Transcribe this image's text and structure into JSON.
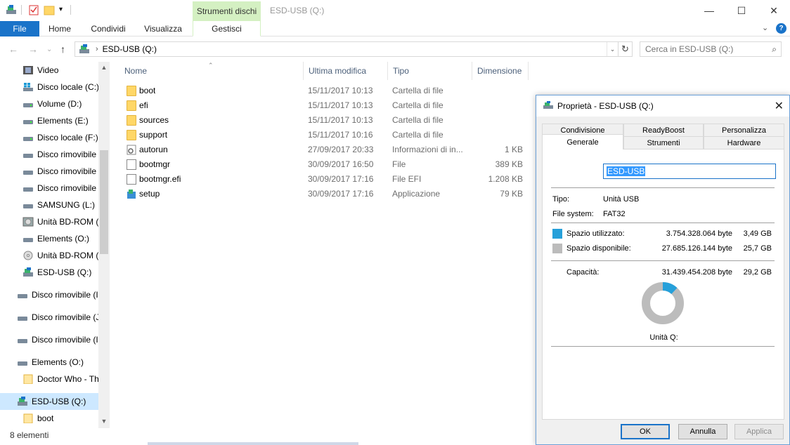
{
  "window": {
    "context_tab_header": "Strumenti dischi",
    "title": "ESD-USB (Q:)",
    "minimize_glyph": "—",
    "maximize_glyph": "☐",
    "close_glyph": "✕"
  },
  "ribbon": {
    "tabs": [
      "File",
      "Home",
      "Condividi",
      "Visualizza"
    ],
    "context_tab": "Gestisci",
    "collapse_glyph": "⌄",
    "help_glyph": "?"
  },
  "address": {
    "back_glyph": "←",
    "forward_glyph": "→",
    "recent_glyph": "⌄",
    "up_glyph": "↑",
    "chevron": "›",
    "path": "ESD-USB (Q:)",
    "dropdown_glyph": "⌄",
    "refresh_glyph": "↻",
    "search_placeholder": "Cerca in ESD-USB (Q:)",
    "search_glyph": "⌕"
  },
  "nav": {
    "items": [
      {
        "label": "Video",
        "icon": "video-icon"
      },
      {
        "label": "Disco locale (C:)",
        "icon": "windows-drive-icon"
      },
      {
        "label": "Volume (D:)",
        "icon": "drive-icon"
      },
      {
        "label": "Elements (E:)",
        "icon": "drive-icon"
      },
      {
        "label": "Disco locale (F:)",
        "icon": "drive-icon"
      },
      {
        "label": "Disco rimovibile",
        "icon": "drive-icon"
      },
      {
        "label": "Disco rimovibile",
        "icon": "drive-icon"
      },
      {
        "label": "Disco rimovibile",
        "icon": "drive-icon"
      },
      {
        "label": "SAMSUNG (L:)",
        "icon": "drive-icon"
      },
      {
        "label": "Unità BD-ROM (",
        "icon": "bd-rom-icon"
      },
      {
        "label": "Elements (O:)",
        "icon": "drive-icon"
      },
      {
        "label": "Unità BD-ROM (",
        "icon": "bd-rom-icon"
      },
      {
        "label": "ESD-USB (Q:)",
        "icon": "usb-drive-icon"
      },
      {
        "label": "Disco rimovibile (I",
        "icon": "drive-icon"
      },
      {
        "label": "Disco rimovibile (J",
        "icon": "drive-icon"
      },
      {
        "label": "Disco rimovibile (I",
        "icon": "drive-icon"
      },
      {
        "label": "Elements (O:)",
        "icon": "drive-icon"
      },
      {
        "label": "Doctor Who - Th",
        "icon": "folder-icon"
      },
      {
        "label": "ESD-USB (Q:)",
        "icon": "usb-drive-icon"
      },
      {
        "label": "boot",
        "icon": "folder-icon"
      }
    ],
    "scroll_up_glyph": "▲",
    "scroll_down_glyph": "▼"
  },
  "files": {
    "columns": {
      "name": "Nome",
      "modified": "Ultima modifica",
      "type": "Tipo",
      "size": "Dimensione"
    },
    "sort_glyph": "⌃",
    "rows": [
      {
        "name": "boot",
        "modified": "15/11/2017 10:13",
        "type": "Cartella di file",
        "size": "",
        "kind": "folder"
      },
      {
        "name": "efi",
        "modified": "15/11/2017 10:13",
        "type": "Cartella di file",
        "size": "",
        "kind": "folder"
      },
      {
        "name": "sources",
        "modified": "15/11/2017 10:13",
        "type": "Cartella di file",
        "size": "",
        "kind": "folder"
      },
      {
        "name": "support",
        "modified": "15/11/2017 10:16",
        "type": "Cartella di file",
        "size": "",
        "kind": "folder"
      },
      {
        "name": "autorun",
        "modified": "27/09/2017 20:33",
        "type": "Informazioni di in...",
        "size": "1 KB",
        "kind": "settings"
      },
      {
        "name": "bootmgr",
        "modified": "30/09/2017 16:50",
        "type": "File",
        "size": "389 KB",
        "kind": "doc"
      },
      {
        "name": "bootmgr.efi",
        "modified": "30/09/2017 17:16",
        "type": "File EFI",
        "size": "1.208 KB",
        "kind": "doc"
      },
      {
        "name": "setup",
        "modified": "30/09/2017 17:16",
        "type": "Applicazione",
        "size": "79 KB",
        "kind": "app"
      }
    ]
  },
  "status": {
    "count": "8 elementi"
  },
  "dialog": {
    "title": "Proprietà - ESD-USB (Q:)",
    "close_glyph": "✕",
    "tabs_back": [
      "Condivisione",
      "ReadyBoost",
      "Personalizza"
    ],
    "tabs_front": [
      "Generale",
      "Strumenti",
      "Hardware"
    ],
    "volume_name": "ESD-USB",
    "type_label": "Tipo:",
    "type_value": "Unità USB",
    "fs_label": "File system:",
    "fs_value": "FAT32",
    "used_label": "Spazio utilizzato:",
    "used_bytes": "3.754.328.064 byte",
    "used_gb": "3,49 GB",
    "free_label": "Spazio disponibile:",
    "free_bytes": "27.685.126.144 byte",
    "free_gb": "25,7 GB",
    "capacity_label": "Capacità:",
    "capacity_bytes": "31.439.454.208 byte",
    "capacity_gb": "29,2 GB",
    "used_fraction": 0.1194,
    "used_color": "#26a0da",
    "free_color": "#bcbcbc",
    "drive_label": "Unità Q:",
    "buttons": {
      "ok": "OK",
      "cancel": "Annulla",
      "apply": "Applica"
    }
  }
}
